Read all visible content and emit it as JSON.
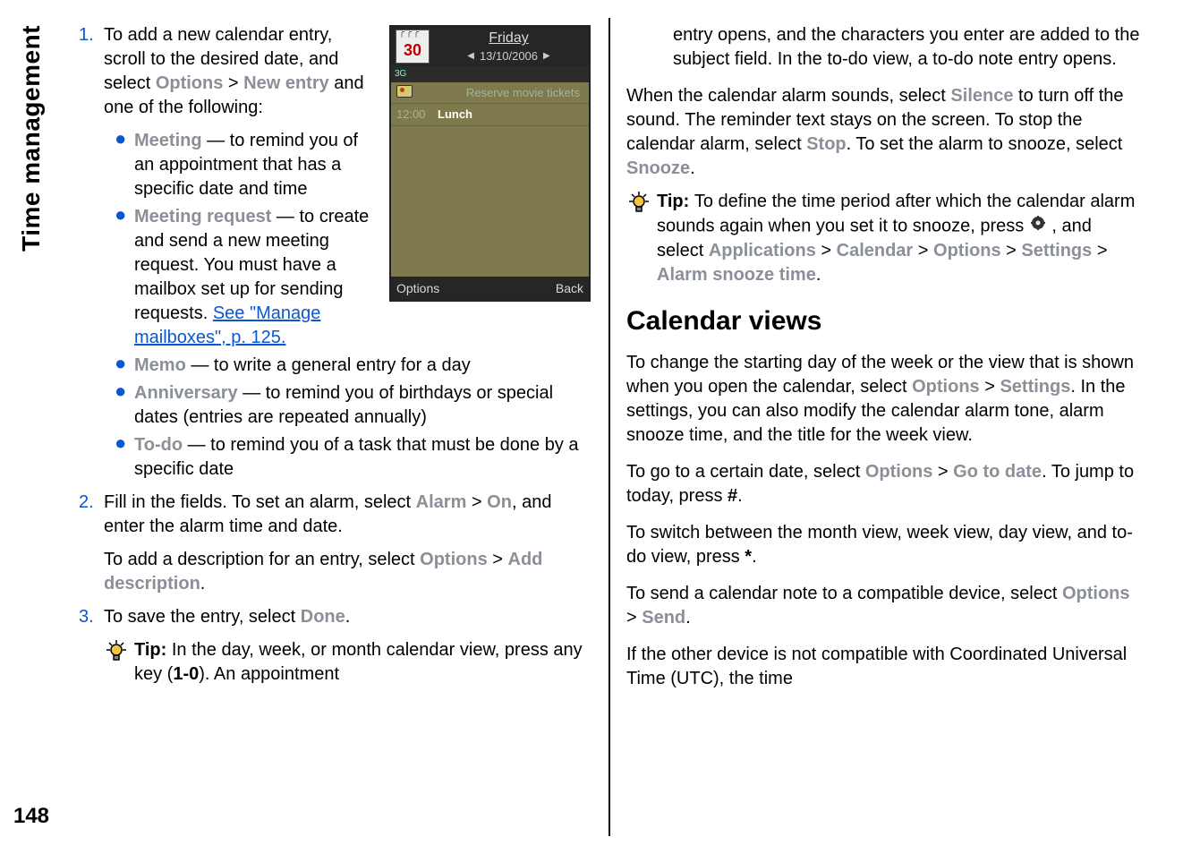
{
  "rail": {
    "title": "Time management",
    "page_number": "148"
  },
  "left": {
    "steps": [
      {
        "num": "1.",
        "intro_pre": "To add a new calendar entry, scroll to the desired date, and select ",
        "path1a": "Options",
        "sep": " > ",
        "path1b": "New entry",
        "intro_post": " and one of the following:",
        "bullets": [
          {
            "label": "Meeting",
            "text": " — to remind you of an appointment that has a specific date and time"
          },
          {
            "label": "Meeting request",
            "text": " — to create and send a new meeting request. You must have a mailbox set up for sending requests. ",
            "link": "See \"Manage mailboxes\", p. 125."
          },
          {
            "label": "Memo",
            "text": " — to write a general entry for a day"
          },
          {
            "label": "Anniversary",
            "text": " — to remind you of birthdays or special dates (entries are repeated annually)"
          },
          {
            "label": "To-do",
            "text": " — to remind you of a task that must be done by a specific date"
          }
        ]
      },
      {
        "num": "2.",
        "line1_pre": "Fill in the fields. To set an alarm, select ",
        "line1_a": "Alarm",
        "line1_sep": " > ",
        "line1_b": "On",
        "line1_post": ", and enter the alarm time and date.",
        "line2_pre": "To add a description for an entry, select ",
        "line2_a": "Options",
        "line2_sep": " > ",
        "line2_b": "Add description",
        "line2_post": "."
      },
      {
        "num": "3.",
        "line_pre": "To save the entry, select ",
        "line_a": "Done",
        "line_post": "."
      }
    ],
    "tip": {
      "label": "Tip:  ",
      "text_pre": "In the day, week, or month calendar view, press any key (",
      "keys": "1-0",
      "text_post": "). An appointment"
    }
  },
  "phone": {
    "icon_day": "30",
    "weekday": "Friday",
    "date": "13/10/2006",
    "net": "3G",
    "memo": "Reserve movie tickets",
    "appt_time": "12:00",
    "appt_title": "Lunch",
    "soft_left": "Options",
    "soft_right": "Back"
  },
  "right": {
    "cont": "entry opens, and the characters you enter are added to the subject field. In the to-do view, a to-do note entry opens.",
    "para2_pre": "When the calendar alarm sounds, select ",
    "p2_a": "Silence",
    "para2_mid1": " to turn off the sound. The reminder text stays on the screen. To stop the calendar alarm, select ",
    "p2_b": "Stop",
    "para2_mid2": ". To set the alarm to snooze, select ",
    "p2_c": "Snooze",
    "para2_post": ".",
    "tip": {
      "label": "Tip:  ",
      "pre": "To define the time period after which the calendar alarm sounds again when you set it to snooze, press ",
      "mid": " , and select ",
      "path": [
        "Applications",
        "Calendar",
        "Options",
        "Settings",
        "Alarm snooze time"
      ],
      "sep": " > ",
      "post": "."
    },
    "heading": "Calendar views",
    "p3_pre": "To change the starting day of the week or the view that is shown when you open the calendar, select ",
    "p3_a": "Options",
    "p3_sep": " > ",
    "p3_b": "Settings",
    "p3_post": ". In the settings, you can also modify the calendar alarm tone, alarm snooze time, and the title for the week view.",
    "p4_pre": "To go to a certain date, select ",
    "p4_a": "Options",
    "p4_sep": " > ",
    "p4_b": "Go to date",
    "p4_mid": ". To jump to today, press ",
    "p4_key": "#",
    "p4_post": ".",
    "p5_pre": "To switch between the month view, week view, day view, and to-do view, press ",
    "p5_key": "*",
    "p5_post": ".",
    "p6_pre": "To send a calendar note to a compatible device, select ",
    "p6_a": "Options",
    "p6_sep": " > ",
    "p6_b": "Send",
    "p6_post": ".",
    "p7": "If the other device is not compatible with Coordinated Universal Time (UTC), the time"
  }
}
